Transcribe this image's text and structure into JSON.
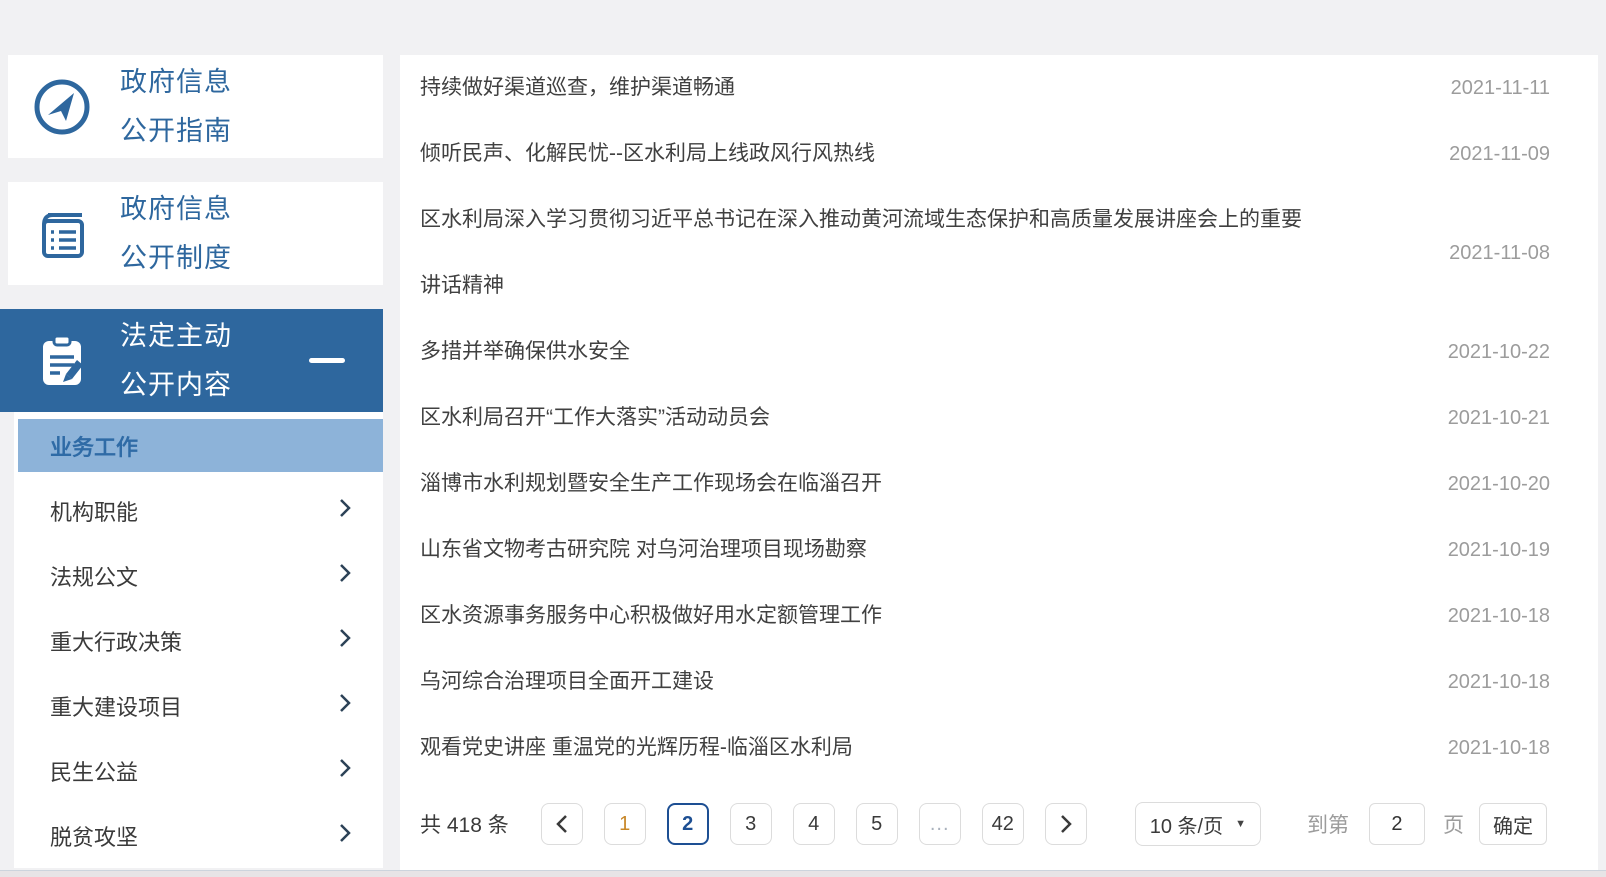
{
  "sidebar": {
    "sections": [
      {
        "lines": [
          "政府信息",
          "公开指南"
        ],
        "icon": "compass-icon",
        "active": false
      },
      {
        "lines": [
          "政府信息",
          "公开制度"
        ],
        "icon": "notebook-icon",
        "active": false
      },
      {
        "lines": [
          "法定主动",
          "公开内容"
        ],
        "icon": "clipboard-pencil-icon",
        "active": true,
        "collapse_indicator": "minus-icon"
      }
    ],
    "submenu": [
      {
        "label": "业务工作",
        "active": true,
        "has_arrow": false
      },
      {
        "label": "机构职能",
        "active": false,
        "has_arrow": true
      },
      {
        "label": "法规公文",
        "active": false,
        "has_arrow": true
      },
      {
        "label": "重大行政决策",
        "active": false,
        "has_arrow": true
      },
      {
        "label": "重大建设项目",
        "active": false,
        "has_arrow": true
      },
      {
        "label": "民生公益",
        "active": false,
        "has_arrow": true
      },
      {
        "label": "脱贫攻坚",
        "active": false,
        "has_arrow": true
      }
    ]
  },
  "news_list": [
    {
      "title": "持续做好渠道巡查，维护渠道畅通",
      "date": "2021-11-11"
    },
    {
      "title": "倾听民声、化解民忧--区水利局上线政风行风热线",
      "date": "2021-11-09"
    },
    {
      "title": "区水利局深入学习贯彻习近平总书记在深入推动黄河流域生态保护和高质量发展讲座会上的重要讲话精神",
      "date": "2021-11-08"
    },
    {
      "title": "多措并举确保供水安全",
      "date": "2021-10-22"
    },
    {
      "title": "区水利局召开“工作大落实”活动动员会",
      "date": "2021-10-21"
    },
    {
      "title": "淄博市水利规划暨安全生产工作现场会在临淄召开",
      "date": "2021-10-20"
    },
    {
      "title": "山东省文物考古研究院 对乌河治理项目现场勘察",
      "date": "2021-10-19"
    },
    {
      "title": "区水资源事务服务中心积极做好用水定额管理工作",
      "date": "2021-10-18"
    },
    {
      "title": "乌河综合治理项目全面开工建设",
      "date": "2021-10-18"
    },
    {
      "title": "观看党史讲座 重温党的光辉历程-临淄区水利局",
      "date": "2021-10-18"
    }
  ],
  "pagination": {
    "total_label": "共 418 条",
    "prev_icon": "chevron-left-icon",
    "next_icon": "chevron-right-icon",
    "pages": [
      {
        "label": "1",
        "style": "visited"
      },
      {
        "label": "2",
        "style": "active"
      },
      {
        "label": "3",
        "style": "normal"
      },
      {
        "label": "4",
        "style": "normal"
      },
      {
        "label": "5",
        "style": "normal"
      },
      {
        "label": "...",
        "style": "ellipsis"
      },
      {
        "label": "42",
        "style": "normal"
      }
    ],
    "current_page": "2",
    "page_size_label": "10 条/页",
    "dropdown_arrow": "▼",
    "goto_prefix": "到第",
    "goto_value": "2",
    "goto_suffix": "页",
    "confirm_label": "确定"
  },
  "colors": {
    "primary_blue": "#2e679e",
    "submenu_highlight": "#8db3d9",
    "active_page_blue": "#1d4f93",
    "visited_page_orange": "#c8882a",
    "date_gray": "#9c9c9c",
    "background_gray": "#f1f1f3"
  }
}
